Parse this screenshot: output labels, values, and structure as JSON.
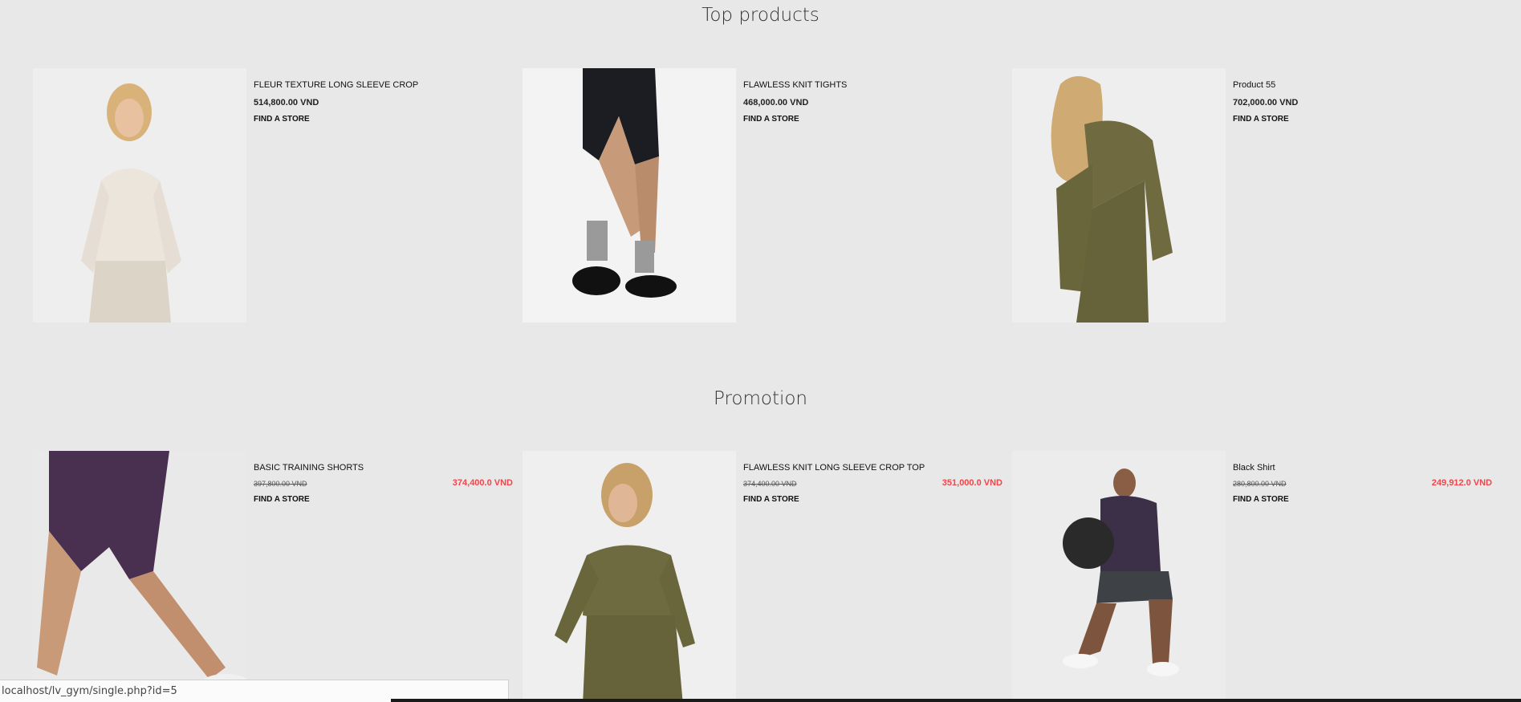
{
  "sections": {
    "top_title": "Top products",
    "promo_title": "Promotion"
  },
  "top_products": [
    {
      "name": "FLEUR TEXTURE LONG SLEEVE CROP",
      "price": "514,800.00 VND",
      "cta": "FIND A STORE"
    },
    {
      "name": "FLAWLESS KNIT TIGHTS",
      "price": "468,000.00 VND",
      "cta": "FIND A STORE"
    },
    {
      "name": "Product 55",
      "price": "702,000.00 VND",
      "cta": "FIND A STORE"
    }
  ],
  "promotion": [
    {
      "name": "BASIC TRAINING SHORTS",
      "old_price": "397,800.00 VND",
      "new_price": "374,400.0 VND",
      "cta": "FIND A STORE"
    },
    {
      "name": "FLAWLESS KNIT LONG SLEEVE CROP TOP",
      "old_price": "374,400.00 VND",
      "new_price": "351,000.0 VND",
      "cta": "FIND A STORE"
    },
    {
      "name": "Black Shirt",
      "old_price": "280,800.00 VND",
      "new_price": "249,912.0 VND",
      "cta": "FIND A STORE"
    }
  ],
  "status_url": "localhost/lv_gym/single.php?id=5",
  "colors": {
    "background": "#e8e8e8",
    "sale_price": "#f0454a"
  }
}
